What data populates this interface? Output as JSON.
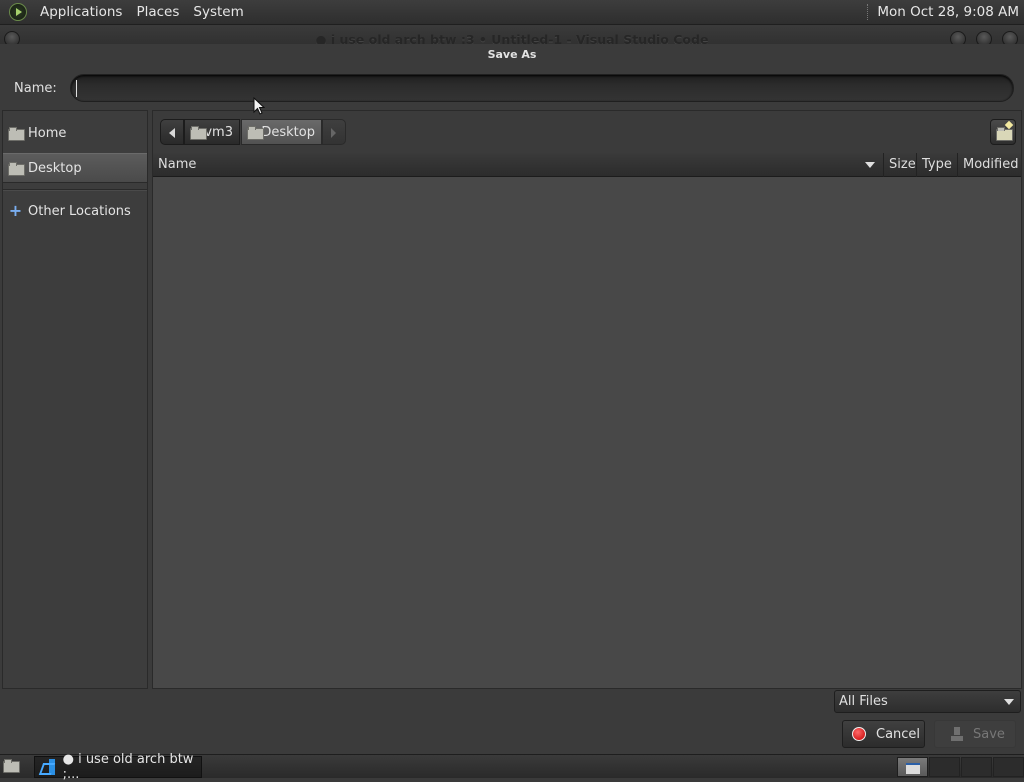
{
  "top_panel": {
    "menus": [
      "Applications",
      "Places",
      "System"
    ],
    "clock": "Mon Oct 28,  9:08 AM"
  },
  "window": {
    "title": "● i use old arch btw :3 • Untitled-1 - Visual Studio Code"
  },
  "dialog": {
    "title": "Save As",
    "name_label": "Name:",
    "name_value": "",
    "sidebar": {
      "items": [
        {
          "label": "Home",
          "icon": "folder-home-icon"
        },
        {
          "label": "Desktop",
          "icon": "folder-desktop-icon",
          "selected": true
        },
        {
          "label": "Other Locations",
          "icon": "plus-icon"
        }
      ]
    },
    "path_bar": {
      "segments": [
        {
          "label": "vm3",
          "icon": "folder-icon"
        },
        {
          "label": "Desktop",
          "icon": "folder-icon",
          "active": true
        }
      ]
    },
    "columns": [
      "Name",
      "Size",
      "Type",
      "Modified"
    ],
    "files": [],
    "filter": "All Files",
    "cancel_label": "Cancel",
    "save_label": "Save"
  },
  "taskbar": {
    "task_label": "● i use old arch btw ;..."
  },
  "colors": {
    "panel_bg": "#2e2e2e",
    "dialog_bg": "#3b3b3b",
    "list_bg": "#484848",
    "cancel_red": "#c40000"
  }
}
